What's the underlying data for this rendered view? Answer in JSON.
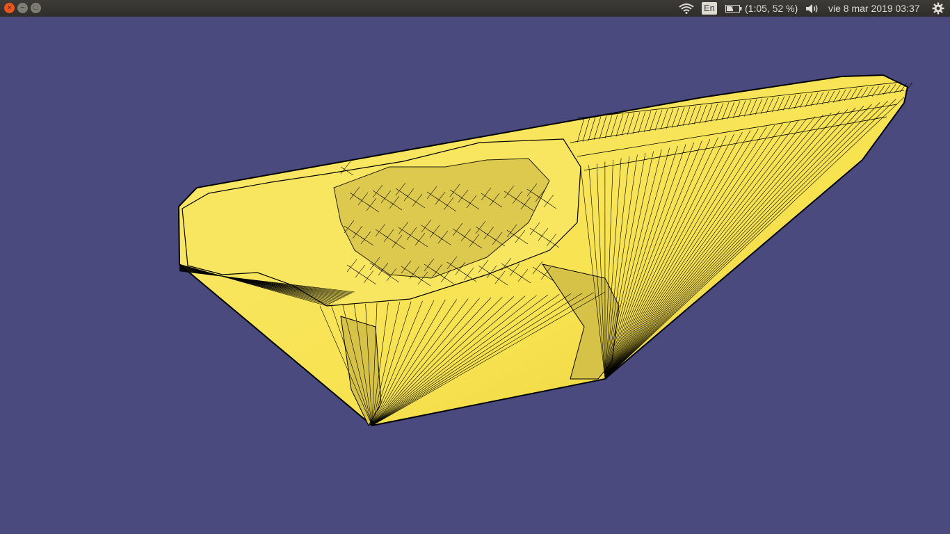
{
  "window": {
    "controls": {
      "close": "×",
      "minimize": "−",
      "maximize": "□"
    }
  },
  "panel": {
    "language": "En",
    "battery_text": "(1:05, 52 %)",
    "clock": "vie  8 mar 2019 03:37",
    "icons": [
      "wifi-icon",
      "battery-icon",
      "volume-icon",
      "gear-icon"
    ]
  },
  "viewport": {
    "background": "#4b4a7f",
    "model_fill": "#f7e24f",
    "model_highlight": "#fbe96e",
    "model_shade": "#e8cc3a",
    "mesh_color": "#000000"
  }
}
